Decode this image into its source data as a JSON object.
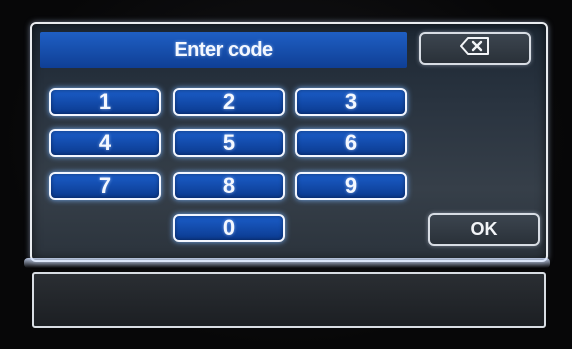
{
  "dialog": {
    "title": "Enter code",
    "backspace_icon": "backspace-icon",
    "ok_label": "OK"
  },
  "keypad": {
    "keys": [
      "1",
      "2",
      "3",
      "4",
      "5",
      "6",
      "7",
      "8",
      "9",
      "0"
    ]
  },
  "colors": {
    "key_blue": "#1b5dc8",
    "title_blue": "#1f5fc4",
    "screen_bg": "#2a3440"
  }
}
